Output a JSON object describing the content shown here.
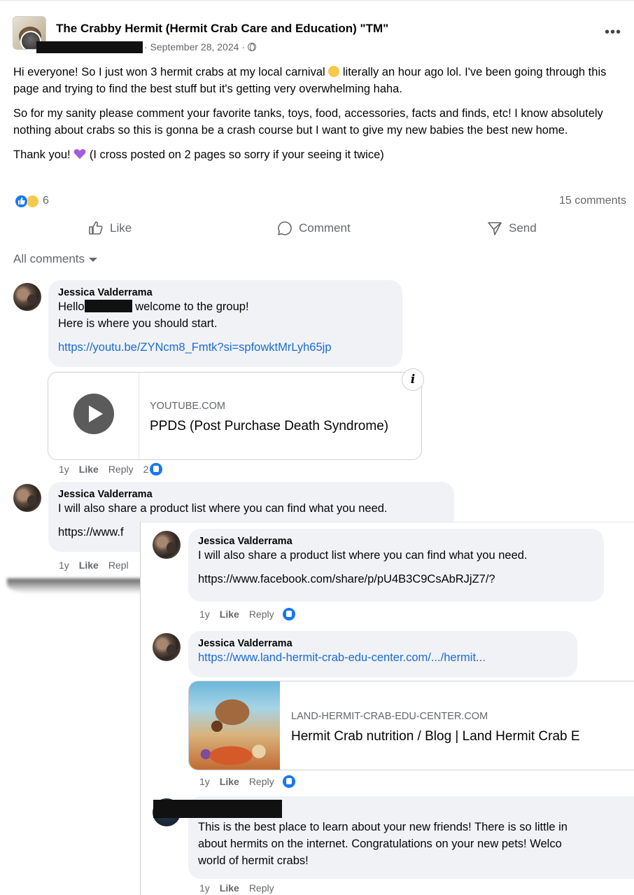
{
  "post": {
    "group_name": "The Crabby Hermit (Hermit Crab Care and Education) \"TM\"",
    "date": "· September 28, 2024 ·",
    "paragraphs": [
      "Hi everyone! So I just won 3 hermit crabs at my local carnival",
      "literally an hour ago lol. I've been going through this page and trying to find the best stuff but it's getting very overwhelming haha.",
      "So for my sanity please comment your favorite tanks, toys, food, accessories, facts and finds, etc! I know absolutely nothing about crabs so this is gonna be a crash course but I want to give my new babies the best new home.",
      "Thank you!",
      "(I cross posted on 2 pages so sorry if your seeing it twice)"
    ],
    "reaction_count": "6",
    "comment_count": "15 comments",
    "actions": {
      "like": "Like",
      "comment": "Comment",
      "send": "Send"
    },
    "all_comments": "All comments"
  },
  "comments": [
    {
      "author": "Jessica Valderrama",
      "text_before": "Hello",
      "text_after": "welcome to the group!",
      "line2": "Here is where you should start.",
      "link": "https://youtu.be/ZYNcm8_Fmtk?si=spfowktMrLyh65jp",
      "card": {
        "domain": "YOUTUBE.COM",
        "title": "PPDS (Post Purchase Death Syndrome)"
      },
      "meta": {
        "age": "1y",
        "like": "Like",
        "reply": "Reply",
        "likes": "2"
      }
    },
    {
      "author": "Jessica Valderrama",
      "text": "I will also share a product list where you can find what you need.",
      "link_truncated": "https://www.f",
      "meta": {
        "age": "1y",
        "like": "Like",
        "reply": "Repl"
      }
    }
  ],
  "overlay": {
    "comments": [
      {
        "author": "Jessica Valderrama",
        "text": "I will also share a product list where you can find what you need.",
        "link": "https://www.facebook.com/share/p/pU4B3C9CsAbRJjZ7/?",
        "meta": {
          "age": "1y",
          "like": "Like",
          "reply": "Reply"
        }
      },
      {
        "author": "Jessica Valderrama",
        "link": "https://www.land-hermit-crab-edu-center.com/.../hermit...",
        "card": {
          "domain": "LAND-HERMIT-CRAB-EDU-CENTER.COM",
          "title": "Hermit Crab nutrition / Blog | Land Hermit Crab E"
        },
        "meta": {
          "age": "1y",
          "like": "Like",
          "reply": "Reply"
        }
      },
      {
        "text_lines": [
          "This is the best place to learn about your new friends! There is so little in",
          "about hermits on the internet. Congratulations on your new pets! Welco",
          "world of hermit crabs!"
        ],
        "meta": {
          "age": "1y",
          "like": "Like",
          "reply": "Reply"
        }
      }
    ]
  },
  "colors": {
    "link": "#1a6bd6",
    "like_blue": "#1877f2",
    "bubble": "#f0f2f5",
    "muted": "#65676b"
  }
}
